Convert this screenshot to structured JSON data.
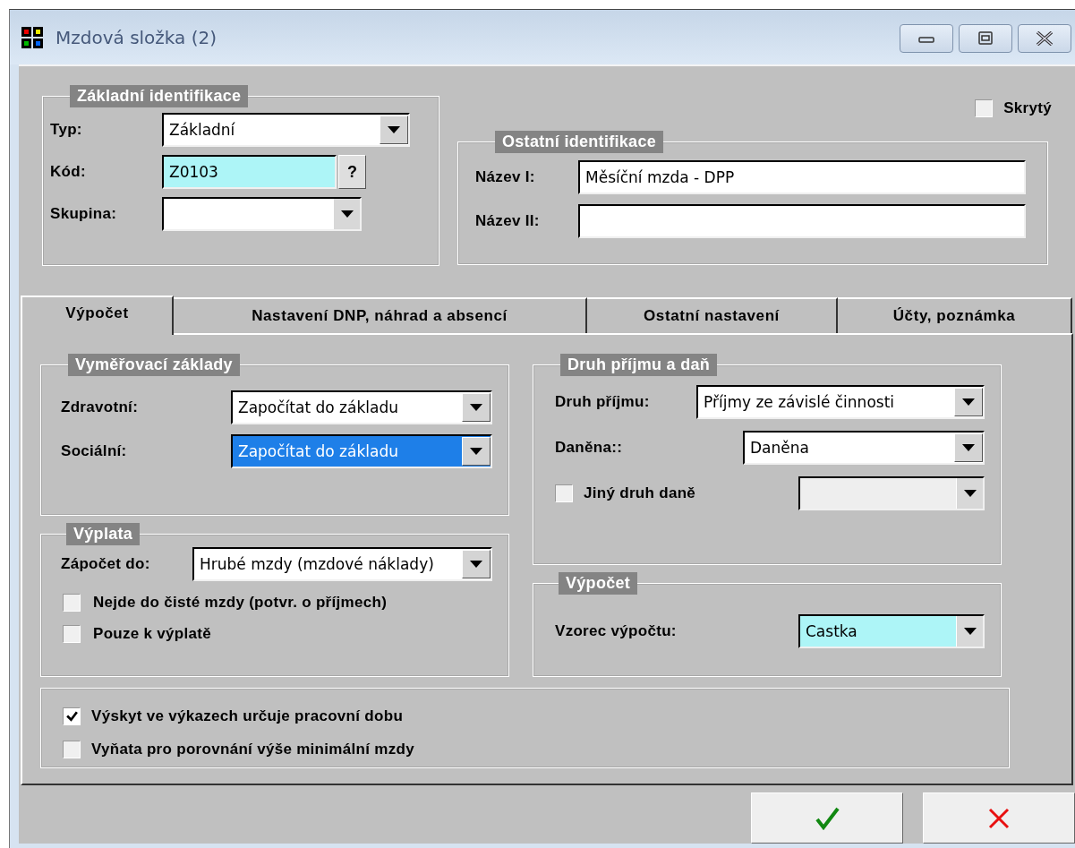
{
  "window": {
    "title": "Mzdová složka (2)"
  },
  "basic_identification": {
    "legend": "Základní identifikace",
    "fields": [
      {
        "label": "Typ:",
        "kind": "combo",
        "value": "Základní",
        "required": false
      },
      {
        "label": "Kód:",
        "kind": "lookup",
        "value": "Z0103",
        "button": "?",
        "required": true
      },
      {
        "label": "Skupina:",
        "kind": "combo",
        "required": false
      }
    ]
  },
  "hidden": {
    "label": "Skrytý",
    "checked": false
  },
  "other_identification": {
    "legend": "Ostatní identifikace",
    "fields": [
      {
        "label": "Název I:",
        "value": "Měsíční mzda - DPP"
      },
      {
        "label": "Název II:"
      }
    ]
  },
  "tabs": [
    {
      "label": "Výpočet",
      "selected": true
    },
    {
      "label": "Nastavení DNP, náhrad a absencí",
      "selected": false
    },
    {
      "label": "Ostatní nastavení",
      "selected": false
    },
    {
      "label": "Účty, poznámka",
      "selected": false
    }
  ],
  "assessment_bases": {
    "legend": "Vyměřovací základy",
    "fields": [
      {
        "label": "Zdravotní:",
        "value": "Započítat do základu",
        "selected": false
      },
      {
        "label": "Sociální:",
        "value": "Započítat do základu",
        "selected": true
      }
    ]
  },
  "payout": {
    "legend": "Výplata",
    "field": {
      "label": "Zápočet do:",
      "value": "Hrubé mzdy (mzdové náklady)"
    },
    "checkboxes": [
      {
        "label": "Nejde do čisté mzdy (potvr. o příjmech)",
        "checked": false
      },
      {
        "label": "Pouze k výplatě",
        "checked": false
      }
    ]
  },
  "income_tax": {
    "legend": "Druh příjmu a daň",
    "fields": [
      {
        "kind": "combo",
        "label": "Druh příjmu:",
        "value": "Příjmy ze závislé činnosti"
      },
      {
        "kind": "combo",
        "label": "Daněna::",
        "value": "Daněna"
      },
      {
        "kind": "checkbox-combo",
        "label": "Jiný druh daně",
        "checked": false,
        "disabled": true
      }
    ]
  },
  "calculation": {
    "legend": "Výpočet",
    "field": {
      "label": "Vzorec výpočtu:",
      "value": "Castka",
      "required": true
    }
  },
  "options": [
    {
      "label": "Výskyt ve výkazech určuje pracovní dobu",
      "checked": true
    },
    {
      "label": "Vyňata pro porovnání výše minimální mzdy",
      "checked": false
    }
  ]
}
